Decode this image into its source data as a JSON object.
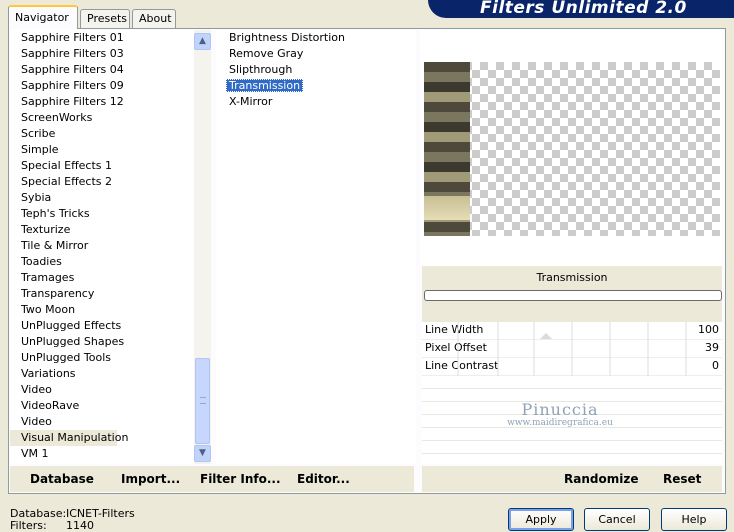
{
  "tabs": [
    {
      "label": "Navigator",
      "active": true
    },
    {
      "label": "Presets",
      "active": false
    },
    {
      "label": "About",
      "active": false
    }
  ],
  "banner": {
    "title": "Filters Unlimited 2.0"
  },
  "categories": [
    "Sapphire Filters 01",
    "Sapphire Filters 03",
    "Sapphire Filters 04",
    "Sapphire Filters 09",
    "Sapphire Filters 12",
    "ScreenWorks",
    "Scribe",
    "Simple",
    "Special Effects 1",
    "Special Effects 2",
    "Sybia",
    "Teph's Tricks",
    "Texturize",
    "Tile & Mirror",
    "Toadies",
    "Tramages",
    "Transparency",
    "Two Moon",
    "UnPlugged Effects",
    "UnPlugged Shapes",
    "UnPlugged Tools",
    "Variations",
    "Video",
    "VideoRave",
    "Video",
    "Visual Manipulation",
    "VM 1"
  ],
  "selected_category": "Visual Manipulation",
  "filters": [
    "Brightness Distortion",
    "Remove Gray",
    "Slipthrough",
    "Transmission",
    "X-Mirror"
  ],
  "selected_filter": "Transmission",
  "filter_title": "Transmission",
  "params": [
    {
      "name": "Line Width",
      "value": "100"
    },
    {
      "name": "Pixel Offset",
      "value": "39"
    },
    {
      "name": "Line Contrast",
      "value": "0"
    }
  ],
  "watermark": {
    "line1": "Pinuccia",
    "line2": "www.maidiregrafica.eu"
  },
  "left_buttons": {
    "database": "Database",
    "import": "Import...",
    "filter_info": "Filter Info...",
    "editor": "Editor..."
  },
  "right_buttons": {
    "randomize": "Randomize",
    "reset": "Reset"
  },
  "status": {
    "database_label": "Database:",
    "database_value": "ICNET-Filters",
    "filters_label": "Filters:",
    "filters_value": "1140"
  },
  "dialog_buttons": {
    "apply": "Apply",
    "cancel": "Cancel",
    "help": "Help"
  }
}
